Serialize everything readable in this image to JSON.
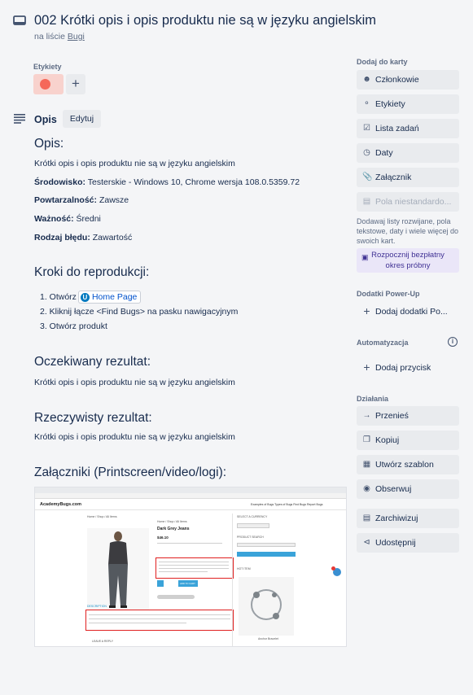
{
  "card": {
    "title": "002 Krótki opis i opis produktu nie są w języku angielskim",
    "list_prefix": "na liście ",
    "list_name": "Bugi"
  },
  "labels": {
    "title": "Etykiety",
    "color": "#f5685a",
    "add": "+"
  },
  "description": {
    "title": "Opis",
    "edit": "Edytuj",
    "heading_opis": "Opis:",
    "opis_text": "Krótki opis i opis produktu nie są w języku angielskim",
    "env_label": "Środowisko:",
    "env_value": " Testerskie - Windows 10, Chrome wersja 108.0.5359.72",
    "rep_label": "Powtarzalność:",
    "rep_value": " Zawsze",
    "sev_label": "Ważność:",
    "sev_value": " Średni",
    "type_label": "Rodzaj błędu:",
    "type_value": " Zawartość",
    "steps_heading": "Kroki do reprodukcji:",
    "step1_prefix": "1. Otwórz",
    "step1_link": "Home Page",
    "step1_link_icon": "U",
    "step2": "2. Kliknij łącze <Find Bugs> na pasku nawigacyjnym",
    "step3": "3. Otwórz produkt",
    "expected_heading": "Oczekiwany rezultat:",
    "expected_text": "Krótki opis i opis produktu nie są w języku angielskim",
    "actual_heading": "Rzeczywisty rezultat:",
    "actual_text": "Krótki opis i opis produktu nie są w języku angielskim",
    "attachments_heading": "Załączniki (Printscreen/video/logi):"
  },
  "attachment_shot": {
    "logo": "AcademyBugs.com",
    "nav": "Examples of Bugs   Types of Bugs   Find Bugs   Report Bugs",
    "breadcrumb": "Home / Shop / All Items",
    "product_breadcrumb": "Home / Shop / All Items",
    "product_name": "Dark Grey Jeans",
    "price": "$46.10",
    "currency_title": "SELECT A CURRENCY",
    "search_title": "PRODUCT SEARCH",
    "hot_title": "HOT ITEM",
    "hot_name": "Anchor Bracelet",
    "desc_tab": "DESCRIPTION",
    "reply": "LEAVE A REPLY",
    "add_cart": "ADD TO CART"
  },
  "sidebar": {
    "add_title": "Dodaj do karty",
    "members": "Członkowie",
    "labels": "Etykiety",
    "checklist": "Lista zadań",
    "dates": "Daty",
    "attachment": "Załącznik",
    "custom_fields": "Pola niestandardo...",
    "custom_note": "Dodawaj listy rozwijane, pola tekstowe, daty i wiele więcej do swoich kart.",
    "trial_line1": "Rozpocznij bezpłatny",
    "trial_line2": "okres próbny",
    "powerups_title": "Dodatki Power-Up",
    "add_powerups": "Dodaj dodatki Po...",
    "automation_title": "Automatyzacja",
    "info": "i",
    "add_button": "Dodaj przycisk",
    "actions_title": "Działania",
    "move": "Przenieś",
    "copy": "Kopiuj",
    "template": "Utwórz szablon",
    "watch": "Obserwuj",
    "archive": "Zarchiwizuj",
    "share": "Udostępnij"
  },
  "colors": {
    "accent": "#0079bf",
    "label_red": "#f5685a",
    "trial_bg": "#eae6f8"
  }
}
